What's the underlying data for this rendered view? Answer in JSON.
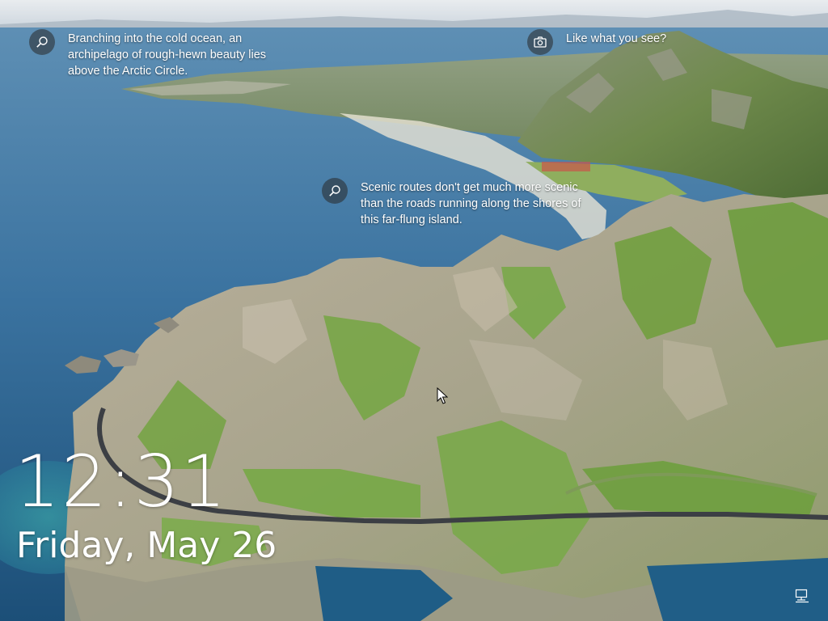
{
  "lock_screen": {
    "spotlight_hints": [
      {
        "icon": "search-icon",
        "text": "Branching into the cold ocean, an archipelago of rough-hewn beauty lies above the Arctic Circle."
      },
      {
        "icon": "camera-icon",
        "text": "Like what you see?"
      },
      {
        "icon": "search-icon",
        "text": "Scenic routes don't get much more scenic than the roads running along the shores of this far-flung island."
      }
    ],
    "time": "12:31",
    "date": "Friday, May 26",
    "status_icons": [
      "network-icon"
    ],
    "background": "aerial-coastal-mountain-road"
  },
  "colors": {
    "text": "#ffffff",
    "icon_circle": "#282828",
    "sea": "#2f6a96",
    "mountain_green": "#7fa84a",
    "rock": "#b3ab9a"
  }
}
